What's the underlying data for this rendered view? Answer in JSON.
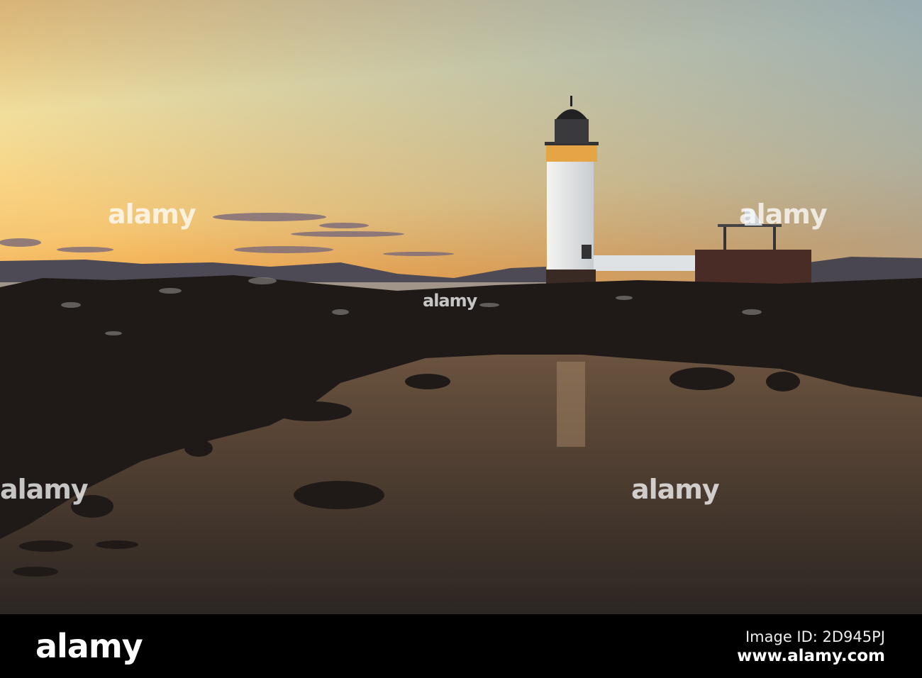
{
  "photo": {
    "subject": "Lighthouse at sunset",
    "colors": {
      "sky_top": "#8fa3b0",
      "sky_glow": "#fbe79a",
      "horizon": "#f2a33c",
      "water": "#4a3a2e",
      "rocks": "#1c1715"
    }
  },
  "watermark": {
    "text": "alamy"
  },
  "footer": {
    "logo": "alamy",
    "image_id": "Image ID: 2D945PJ",
    "website": "www.alamy.com"
  }
}
